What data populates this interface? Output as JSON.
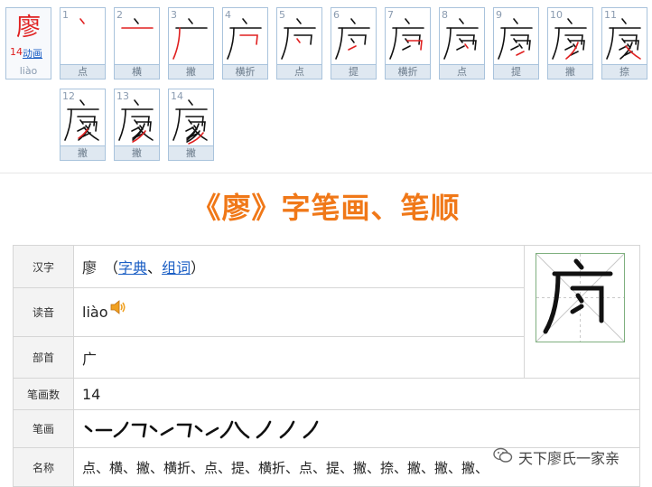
{
  "character": {
    "glyph": "廖",
    "stroke_count": "14",
    "animation_link": "动画",
    "pinyin": "liào"
  },
  "steps": [
    {
      "num": "1",
      "label": "点"
    },
    {
      "num": "2",
      "label": "横"
    },
    {
      "num": "3",
      "label": "撇"
    },
    {
      "num": "4",
      "label": "横折"
    },
    {
      "num": "5",
      "label": "点"
    },
    {
      "num": "6",
      "label": "提"
    },
    {
      "num": "7",
      "label": "横折"
    },
    {
      "num": "8",
      "label": "点"
    },
    {
      "num": "9",
      "label": "提"
    },
    {
      "num": "10",
      "label": "撇"
    },
    {
      "num": "11",
      "label": "捺"
    },
    {
      "num": "12",
      "label": "撇"
    },
    {
      "num": "13",
      "label": "撇"
    },
    {
      "num": "14",
      "label": "撇"
    }
  ],
  "title": "《廖》字笔画、笔顺",
  "table": {
    "hanzi": {
      "label": "汉字",
      "value": "廖",
      "open": "（",
      "dict_link": "字典",
      "sep": "、",
      "words_link": "组词",
      "close": "）"
    },
    "reading": {
      "label": "读音",
      "value": "liào"
    },
    "radical": {
      "label": "部首",
      "value": "广"
    },
    "count": {
      "label": "笔画数",
      "value": "14"
    },
    "strokes": {
      "label": "笔画"
    },
    "names": {
      "label": "名称",
      "value": "点、横、撇、横折、点、提、横折、点、提、撇、捺、撇、撇、撇、"
    }
  },
  "watermark": "天下廖氏一家亲",
  "icons": {
    "speaker": "speaker-icon",
    "wechat": "wechat-icon"
  },
  "colors": {
    "accent": "#f07818",
    "stroke_highlight": "#e02020",
    "link": "#1a5ec4"
  }
}
